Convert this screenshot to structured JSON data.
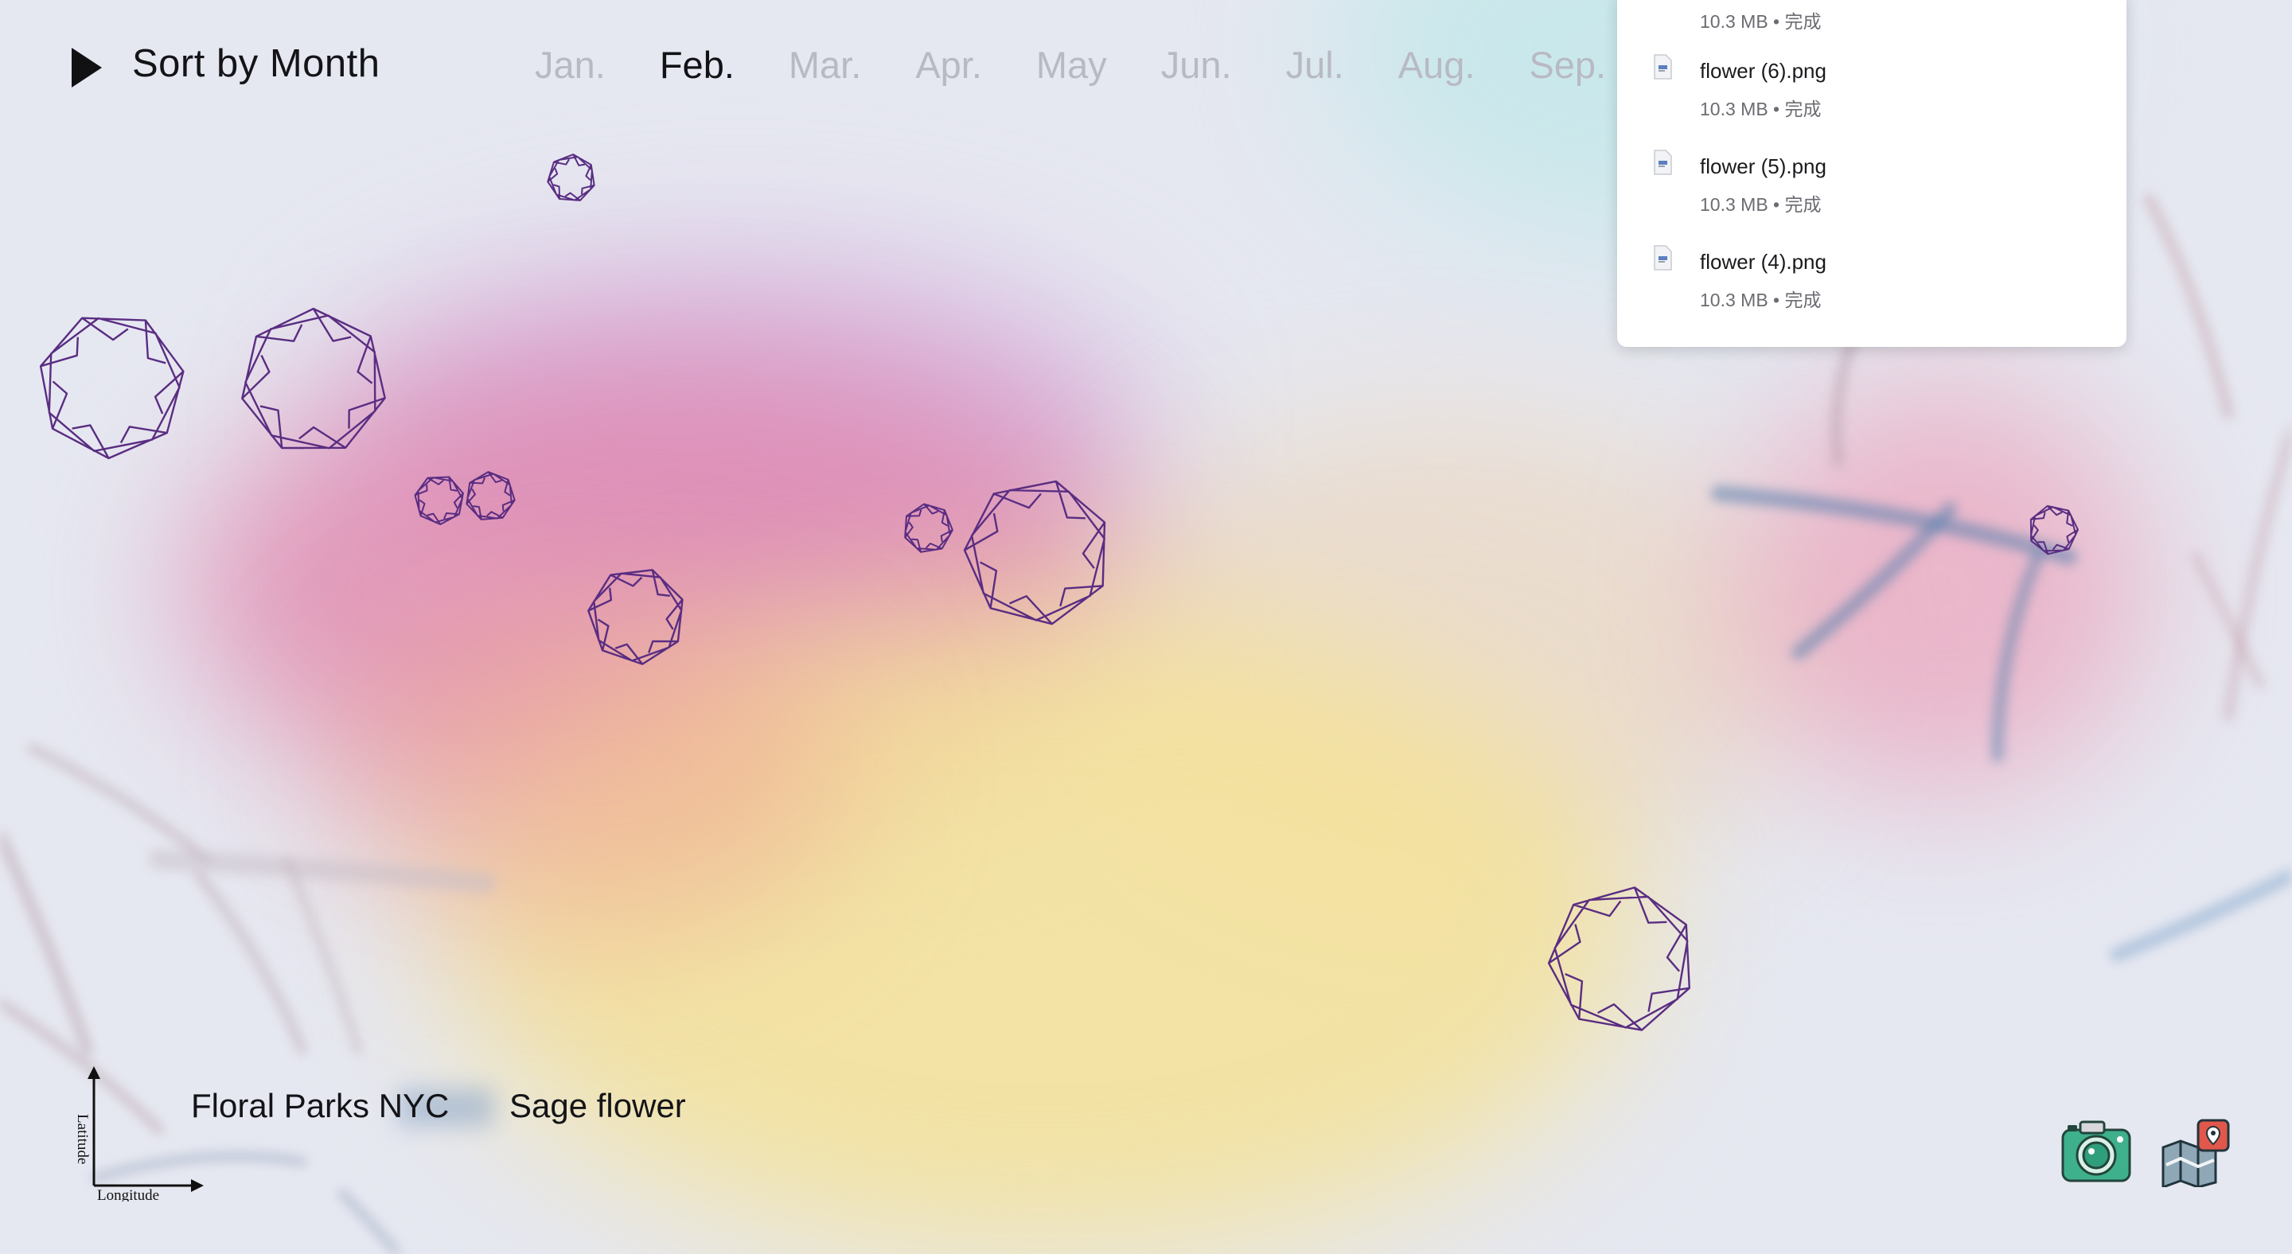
{
  "header": {
    "title": "Sort by Month",
    "play_icon": "play-icon",
    "months": [
      {
        "label": "Jan.",
        "active": false
      },
      {
        "label": "Feb.",
        "active": true
      },
      {
        "label": "Mar.",
        "active": false
      },
      {
        "label": "Apr.",
        "active": false
      },
      {
        "label": "May",
        "active": false
      },
      {
        "label": "Jun.",
        "active": false
      },
      {
        "label": "Jul.",
        "active": false
      },
      {
        "label": "Aug.",
        "active": false
      },
      {
        "label": "Sep.",
        "active": false
      }
    ]
  },
  "downloads": {
    "items": [
      {
        "name": "",
        "meta": "10.3 MB • 完成"
      },
      {
        "name": "flower (6).png",
        "meta": "10.3 MB • 完成"
      },
      {
        "name": "flower (5).png",
        "meta": "10.3 MB • 完成"
      },
      {
        "name": "flower (4).png",
        "meta": "10.3 MB • 完成"
      }
    ],
    "file_icon": "file-icon"
  },
  "bottom": {
    "axis_y_label": "Latitude",
    "axis_x_label": "Longitude",
    "location": "Floral Parks NYC",
    "flower": "Sage flower",
    "camera_icon": "camera-icon",
    "map_icon": "map-icon"
  },
  "colors": {
    "flower_stroke": "#5a2d82",
    "active_month": "#121216",
    "inactive_month": "#b8bac3",
    "camera_green": "#3fb08c",
    "map_red": "#e2574c"
  }
}
